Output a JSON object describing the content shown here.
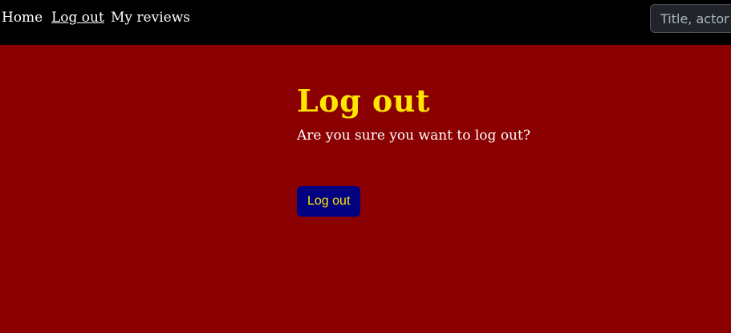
{
  "nav": {
    "home": "Home",
    "logout": "Log out",
    "reviews": "My reviews"
  },
  "search": {
    "placeholder": "Title, actor or director"
  },
  "main": {
    "title": "Log out",
    "message": "Are you sure you want to log out?",
    "button_label": "Log out"
  },
  "colors": {
    "background": "#8b0000",
    "navbar": "#000000",
    "title": "#ffe600",
    "button_bg": "#000080",
    "button_text": "#ffe600"
  }
}
